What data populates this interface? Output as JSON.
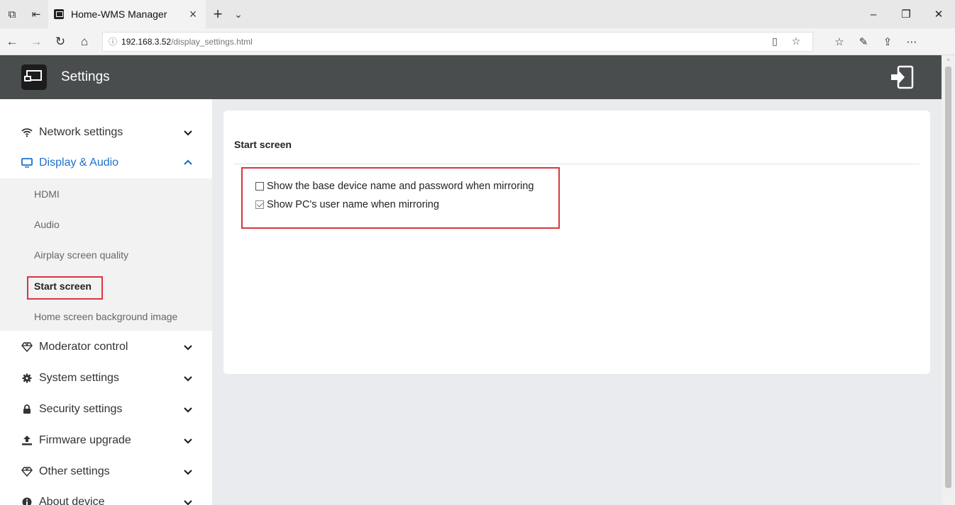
{
  "browser": {
    "tab_title": "Home-WMS Manager",
    "url_host": "192.168.3.52",
    "url_path": "/display_settings.html"
  },
  "app": {
    "title": "Settings"
  },
  "sidebar": {
    "items": [
      {
        "label": "Network settings",
        "icon": "wifi-icon",
        "expanded": false
      },
      {
        "label": "Display & Audio",
        "icon": "monitor-icon",
        "expanded": true
      },
      {
        "label": "Moderator control",
        "icon": "diamond-icon",
        "expanded": false
      },
      {
        "label": "System settings",
        "icon": "cog-icon",
        "expanded": false
      },
      {
        "label": "Security settings",
        "icon": "lock-icon",
        "expanded": false
      },
      {
        "label": "Firmware upgrade",
        "icon": "upload-icon",
        "expanded": false
      },
      {
        "label": "Other settings",
        "icon": "diamond-icon",
        "expanded": false
      },
      {
        "label": "About device",
        "icon": "info-icon",
        "expanded": false
      }
    ],
    "subitems": [
      {
        "label": "HDMI"
      },
      {
        "label": "Audio"
      },
      {
        "label": "Airplay screen quality"
      },
      {
        "label": "Start screen",
        "selected": true
      },
      {
        "label": "Home screen background image"
      }
    ]
  },
  "main": {
    "card_title": "Start screen",
    "options": [
      {
        "label": "Show the base device name and password when mirroring",
        "checked": false
      },
      {
        "label": "Show PC's user name when mirroring",
        "checked": true
      }
    ]
  },
  "colors": {
    "header_bg": "#4a4d4d",
    "active_blue": "#1f6fc9",
    "highlight_red": "#d9363e",
    "main_bg": "#eaebee"
  }
}
